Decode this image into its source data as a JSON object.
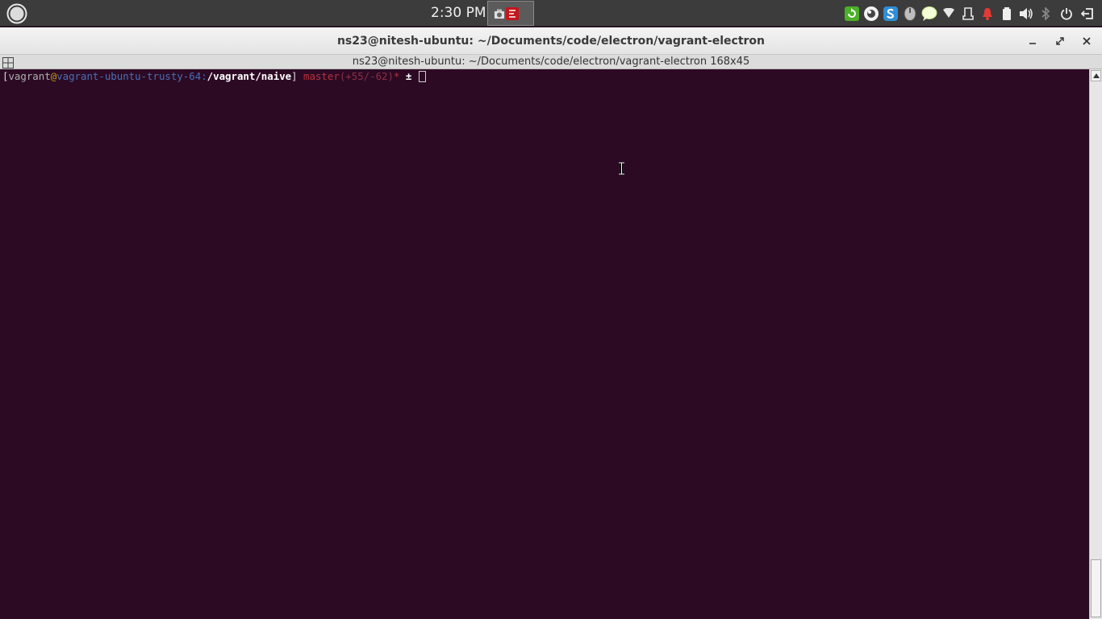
{
  "top_panel": {
    "clock": "2:30 PM",
    "menu_icon": "circle-menu-icon",
    "taskbar_icons": [
      "screenshot-icon",
      "app-icon"
    ],
    "tray_icons": [
      "update-manager-icon",
      "cloud-sync-icon",
      "skype-icon",
      "mouse-icon",
      "chat-bubble-icon",
      "wifi-icon",
      "usb-drive-icon",
      "notification-bell-icon",
      "battery-icon",
      "volume-icon",
      "bluetooth-icon",
      "power-icon",
      "logout-icon"
    ]
  },
  "window": {
    "title": "ns23@nitesh-ubuntu: ~/Documents/code/electron/vagrant-electron",
    "controls": [
      "minimize-icon",
      "maximize-icon",
      "close-icon"
    ]
  },
  "terminal": {
    "info_title": "ns23@nitesh-ubuntu: ~/Documents/code/electron/vagrant-electron 168x45",
    "prompt": {
      "open_bracket": "[",
      "user": "vagrant",
      "at": "@",
      "host": "vagrant-ubuntu-trusty-64",
      "colon": ":",
      "path": "/vagrant/naive",
      "close_bracket": "]",
      "branch": "master",
      "changes": "(+55/-62)",
      "dirty": "*",
      "symbol": "±"
    }
  },
  "colors": {
    "terminal_bg": "#2c0a24",
    "panel_bg": "#3c3c3c",
    "host": "#4a6fb5",
    "branch": "#b8313c",
    "at": "#c8a000"
  }
}
